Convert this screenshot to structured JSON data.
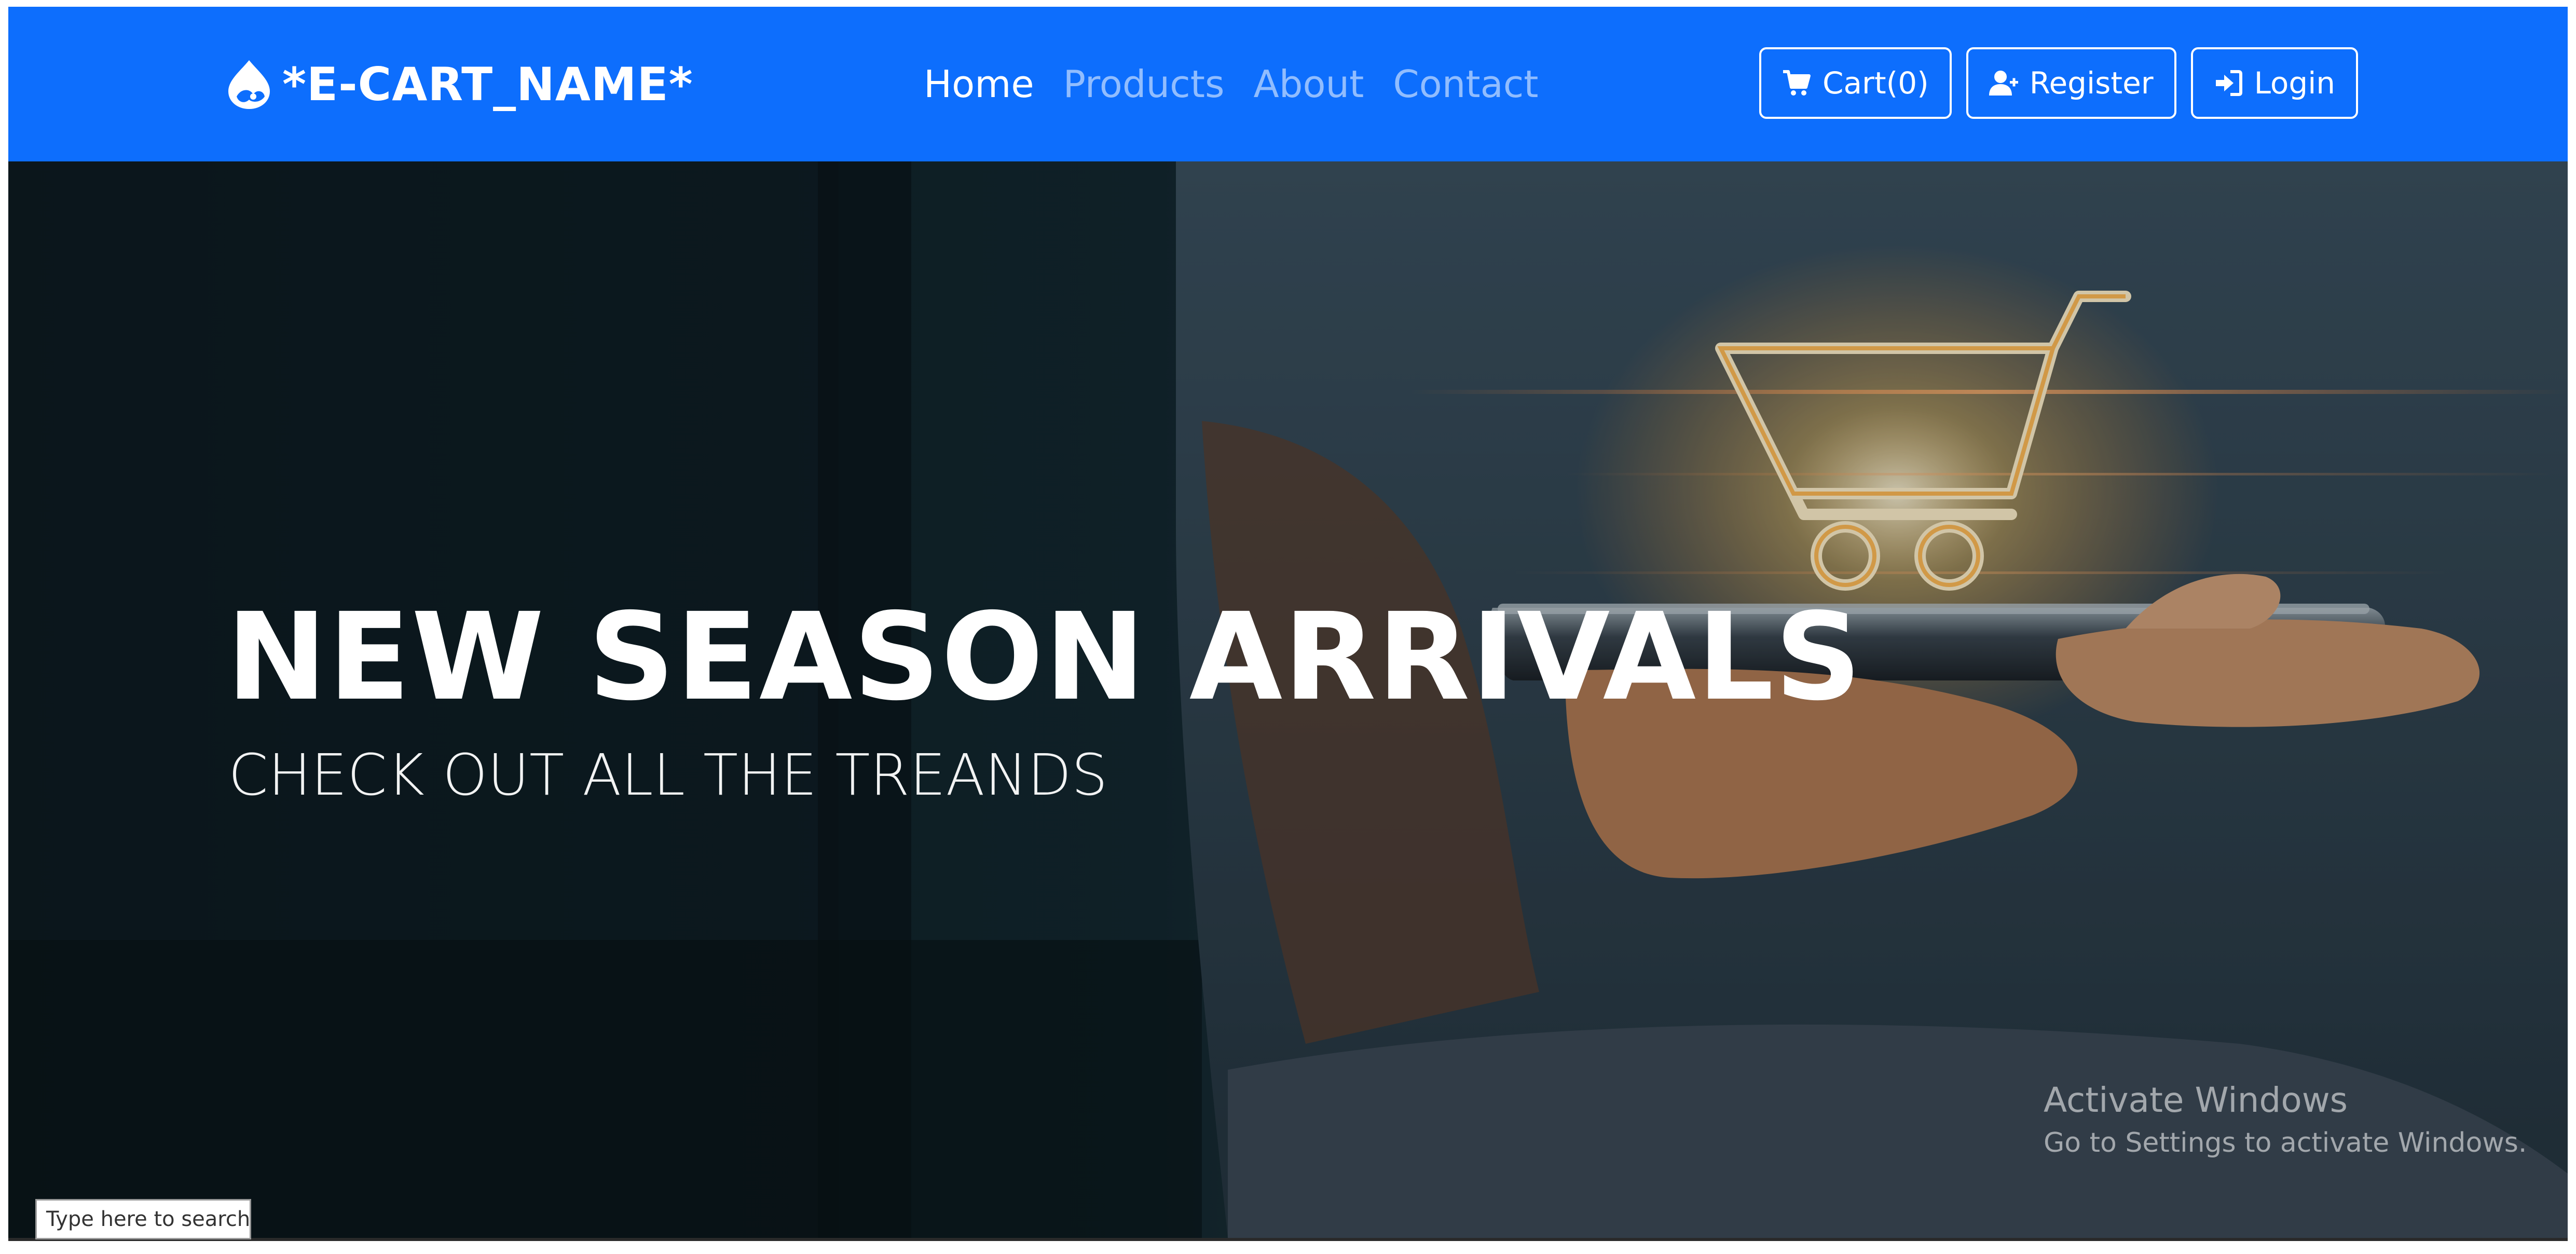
{
  "navbar": {
    "brand": "*E-CART_NAME*",
    "brand_icon": "drupal-drop-icon",
    "links": [
      {
        "label": "Home",
        "active": true
      },
      {
        "label": "Products",
        "active": false
      },
      {
        "label": "About",
        "active": false
      },
      {
        "label": "Contact",
        "active": false
      }
    ],
    "buttons": {
      "cart": {
        "label": "Cart(0)",
        "icon": "shopping-cart-icon"
      },
      "register": {
        "label": "Register",
        "icon": "user-plus-icon"
      },
      "login": {
        "label": "Login",
        "icon": "sign-in-icon"
      }
    },
    "colors": {
      "background": "#0d6efd",
      "text": "#ffffff"
    }
  },
  "hero": {
    "title": "NEW SEASON ARRIVALS",
    "subtitle": "CHECK OUT ALL THE TREANDS",
    "image": "person-holding-tablet-with-glowing-shopping-cart"
  },
  "overlay": {
    "activate_title": "Activate Windows",
    "activate_sub": "Go to Settings to activate Windows.",
    "taskbar_search_placeholder": "Type here to search"
  }
}
